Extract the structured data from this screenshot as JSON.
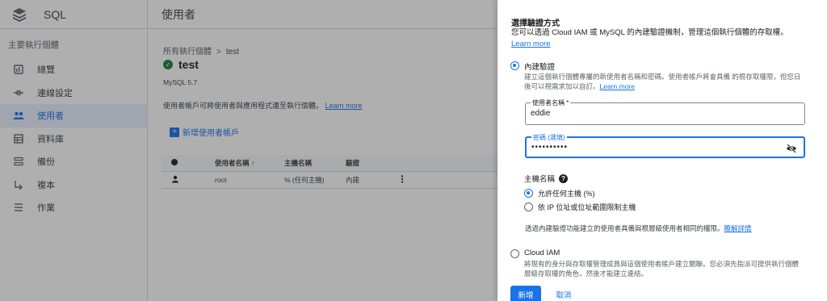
{
  "app": {
    "product_name": "SQL",
    "page_header": "使用者"
  },
  "sidebar": {
    "section_title": "主要執行個體",
    "items": [
      {
        "label": "總覽",
        "icon": "dashboard-icon"
      },
      {
        "label": "連線設定",
        "icon": "connections-icon"
      },
      {
        "label": "使用者",
        "icon": "users-icon",
        "active": true
      },
      {
        "label": "資料庫",
        "icon": "database-icon"
      },
      {
        "label": "備份",
        "icon": "backup-icon"
      },
      {
        "label": "複本",
        "icon": "replica-icon"
      },
      {
        "label": "作業",
        "icon": "operations-icon"
      }
    ]
  },
  "main": {
    "breadcrumb": {
      "root": "所有執行個體",
      "separator": ">",
      "current": "test"
    },
    "instance_name": "test",
    "instance_version": "MySQL 5.7",
    "description": "使用者帳戶可將使用者與應用程式連至執行個體。",
    "learn_more": "Learn more",
    "add_button": "新增使用者帳戶",
    "table": {
      "columns": [
        "使用者名稱",
        "主機名稱",
        "驗證"
      ],
      "sort_indicator": "↑",
      "rows": [
        {
          "username": "root",
          "host": "% (任何主機)",
          "auth": "內建"
        }
      ]
    }
  },
  "panel": {
    "title": "選擇驗證方式",
    "subtitle": "您可以透過 Cloud IAM 或 MySQL 的內建驗證機制，管理這個執行個體的存取權。",
    "subtitle_link": "Learn more",
    "builtin": {
      "label": "內建驗證",
      "selected": true,
      "description_1": "建立這個執行個體專屬的新使用者名稱和密碼。使用者帳戶將會具備 的根存取權限，但您日",
      "description_2": "後可以視需求加以自訂。",
      "description_link": "Learn more"
    },
    "username_field": {
      "label": "使用者名稱 *",
      "value": "eddie"
    },
    "password_field": {
      "label": "密碼 (選填)",
      "value": "••••••••••"
    },
    "host": {
      "heading": "主機名稱",
      "options": [
        {
          "label": "允許任何主機 (%)",
          "selected": true
        },
        {
          "label": "依 IP 位址或位址範圍限制主機",
          "selected": false
        }
      ]
    },
    "note": "透過內建驗證功能建立的使用者具備與根層級使用者相同的權限。",
    "note_link": "瞭解詳情",
    "cloud_iam": {
      "label": "Cloud IAM",
      "selected": false,
      "description_1": "將現有的身分與存取權管理成員與這個使用者帳戶建立關聯。您必須先指派可提供執行個體",
      "description_2": "層級存取權的角色，然後才能建立連結。"
    },
    "actions": {
      "add": "新增",
      "cancel": "取消"
    }
  },
  "colors": {
    "accent": "#1a73e8",
    "success": "#188038"
  }
}
